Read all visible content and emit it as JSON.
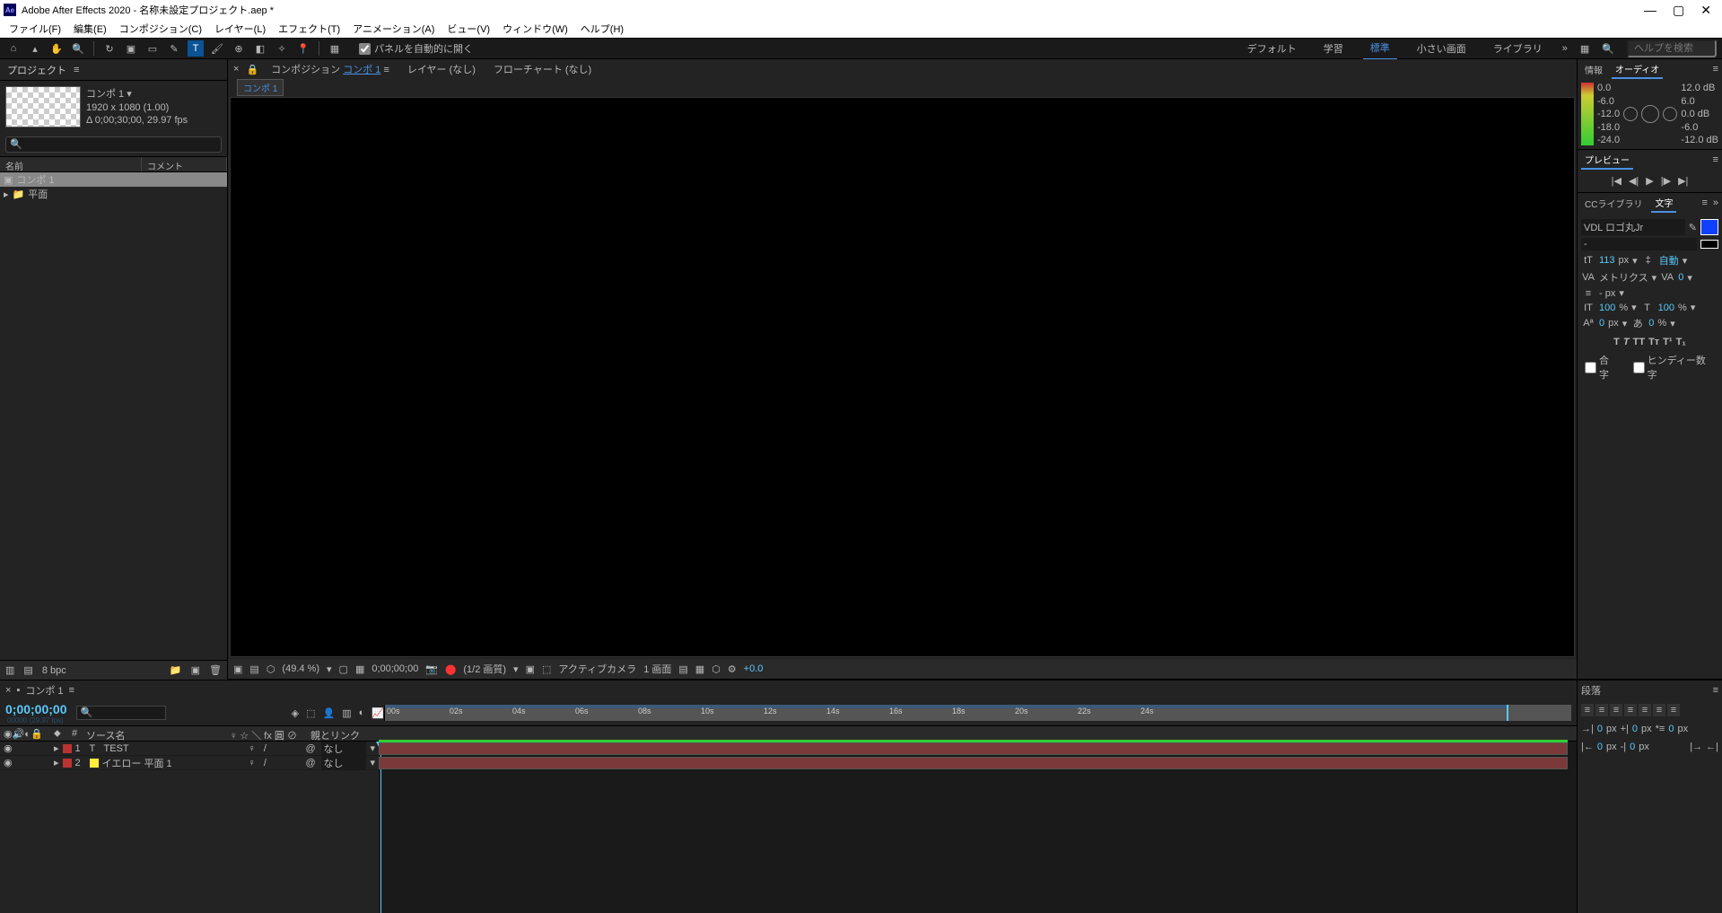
{
  "title": "Adobe After Effects 2020 - 名称未設定プロジェクト.aep *",
  "menubar": [
    "ファイル(F)",
    "編集(E)",
    "コンポジション(C)",
    "レイヤー(L)",
    "エフェクト(T)",
    "アニメーション(A)",
    "ビュー(V)",
    "ウィンドウ(W)",
    "ヘルプ(H)"
  ],
  "toolbar": {
    "autoopen": "パネルを自動的に開く",
    "workspaces": [
      "デフォルト",
      "学習",
      "標準",
      "小さい画面",
      "ライブラリ"
    ],
    "active_ws": "標準",
    "search_placeholder": "ヘルプを検索"
  },
  "project": {
    "tab": "プロジェクト",
    "comp_name": "コンポ 1 ▾",
    "resolution": "1920 x 1080 (1.00)",
    "duration": "Δ 0;00;30;00, 29.97 fps",
    "cols": {
      "name": "名前",
      "comment": "コメント"
    },
    "items": [
      {
        "icon": "comp",
        "name": "コンポ 1",
        "selected": true
      },
      {
        "icon": "folder",
        "name": "平面",
        "selected": false
      }
    ],
    "bpc": "8 bpc"
  },
  "comp_panel": {
    "tabs": [
      {
        "prefix": "コンポジション",
        "name": "コンポ 1",
        "active": true
      },
      {
        "prefix": "レイヤー",
        "name": "(なし)",
        "active": false
      },
      {
        "prefix": "フローチャート",
        "name": "(なし)",
        "active": false
      }
    ],
    "breadcrumb": "コンポ 1",
    "footer": {
      "zoom": "(49.4 %)",
      "time": "0;00;00;00",
      "quality": "(1/2 画質)",
      "camera": "アクティブカメラ",
      "view": "1 画面",
      "exposure": "+0.0"
    }
  },
  "right": {
    "info": "情報",
    "audio": "オーディオ",
    "meter_left": [
      "0.0",
      "-6.0",
      "-12.0",
      "-18.0",
      "-24.0"
    ],
    "meter_right": [
      "12.0 dB",
      "6.0",
      "0.0 dB",
      "-6.0",
      "-12.0 dB"
    ],
    "preview": "プレビュー",
    "cc": "CCライブラリ",
    "char": "文字",
    "font": "VDL ロゴ丸Jr",
    "fontstyle": "-",
    "fontsize": "113",
    "fontunit": "px",
    "leading": "自動",
    "kerning": "メトリクス",
    "tracking": "0",
    "tsume": "- px",
    "vscale": "100",
    "hscale": "100",
    "vunit": "%",
    "hunit": "%",
    "baseline": "0",
    "strokewidth": "0",
    "bunit": "px",
    "ligature": "合字",
    "hindi": "ヒンディー数字"
  },
  "timeline": {
    "tab": "コンポ 1",
    "time": "0;00;00;00",
    "frames": "00000 (29.97 fps)",
    "cols": {
      "source": "ソース名",
      "switches": "♀ ☆ ＼ fx 圓 ⊘ ⊙ ⊗",
      "parent": "親とリンク"
    },
    "ruler": [
      "00s",
      "02s",
      "04s",
      "06s",
      "08s",
      "10s",
      "12s",
      "14s",
      "16s",
      "18s",
      "20s",
      "22s",
      "24s"
    ],
    "layers": [
      {
        "num": "1",
        "color": "red",
        "type": "T",
        "name": "TEST",
        "parent": "なし"
      },
      {
        "num": "2",
        "color": "red",
        "solid": "yellow",
        "name": "イエロー 平面 1",
        "parent": "なし"
      }
    ]
  },
  "paragraph": {
    "tab": "段落",
    "indent_left": "0",
    "indent_right": "0",
    "first_line": "0",
    "space_before": "0",
    "space_after": "0",
    "punit": "px"
  }
}
